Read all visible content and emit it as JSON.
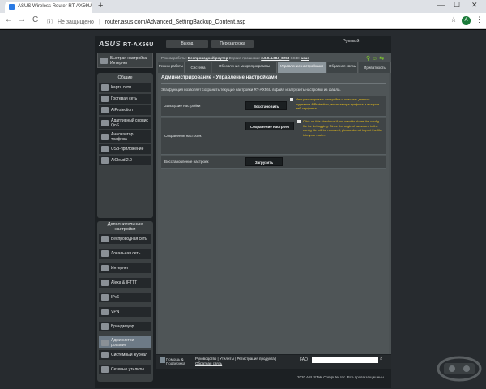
{
  "browser": {
    "tab_title": "ASUS Wireless Router RT-AX56U",
    "tab_close": "×",
    "new_tab": "+",
    "win_min": "—",
    "win_max": "☐",
    "win_close": "✕",
    "back": "←",
    "forward": "→",
    "reload": "C",
    "insecure_label": "Не защищено",
    "separator": "|",
    "url": "router.asus.com/Advanced_SettingBackup_Content.asp",
    "star": "☆",
    "avatar_letter": "A",
    "menu": "⋮"
  },
  "router": {
    "logo": "ASUS",
    "model": "RT-AX56U",
    "logout_label": "Выход",
    "reboot_label": "Перезагрузка",
    "language": "Русский",
    "status": {
      "mode_label": "Режим работы:",
      "mode_value": "Беспроводной роутер",
      "firmware_label": "Версия прошивки:",
      "firmware_value": "3.0.0.4.384_8253",
      "ssid_label": "SSID:",
      "ssid_value": "asus"
    },
    "sidebar": {
      "quick_setup": "Быстрая настройка Интернет",
      "general_header": "Общие",
      "general_items": [
        {
          "label": "Карта сети"
        },
        {
          "label": "Гостевая сеть"
        },
        {
          "label": "AiProtection"
        },
        {
          "label": "Адаптивный сервис QoS"
        },
        {
          "label": "Анализатор трафика"
        },
        {
          "label": "USB-приложение"
        },
        {
          "label": "AiCloud 2.0"
        }
      ],
      "advanced_header": "Дополнительные настройки",
      "advanced_items": [
        {
          "label": "Беспроводная сеть"
        },
        {
          "label": "Локальная сеть"
        },
        {
          "label": "Интернет"
        },
        {
          "label": "Alexa & IFTTT"
        },
        {
          "label": "IPv6"
        },
        {
          "label": "VPN"
        },
        {
          "label": "Брандмауэр"
        },
        {
          "label": "Администри-рование"
        },
        {
          "label": "Системный журнал"
        },
        {
          "label": "Сетевые утилиты"
        }
      ],
      "active_index": 7
    },
    "tabs": [
      {
        "label": "Режим работы"
      },
      {
        "label": "Система"
      },
      {
        "label": "Обновление микропрограммы"
      },
      {
        "label": "Управление настройками"
      },
      {
        "label": "Обратная связь"
      },
      {
        "label": "Приватность"
      }
    ],
    "panel": {
      "title": "Администрирование - Управление настройками",
      "description": "Эта функция позволяет сохранить текущие настройки RT-AX56U в файл и загрузить настройки из файла.",
      "rows": [
        {
          "label": "Заводские настройки",
          "button": "Восстановить",
          "note": "Инициализировать настройки и очистить данные журналов AiProtection, анализатора трафика и истории веб-серфинга."
        },
        {
          "label": "Сохранение настроек",
          "button": "Сохранение настроек",
          "note": "Click on this checkbox if you want to share the config file for debugging. Since the original password in the config file will be removed, please do not import the file into your router."
        },
        {
          "label": "Восстановление настроек",
          "button": "Загрузить"
        }
      ]
    },
    "footer": {
      "help": "Помощь & Поддержка",
      "links": "Руководство | Утилиты | Регистрация продукта | Обратная связь",
      "faq": "FAQ",
      "copyright": "2020 ASUSTeK Computer Inc. Все права защищены."
    }
  },
  "colors": {
    "accent_green": "#83d42a",
    "note_yellow": "#f0c419",
    "active_item": "#6d7a86"
  }
}
